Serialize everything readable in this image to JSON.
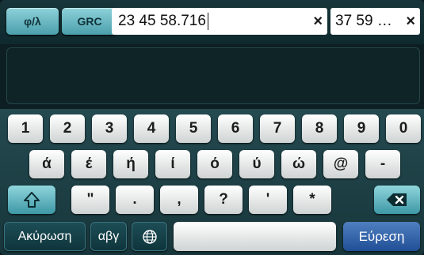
{
  "topbar": {
    "mode_phi_label": "φ/λ",
    "mode_grc_label": "GRC",
    "lon_value": "23 45 58.716",
    "lat_value": "37 59 …",
    "clear_symbol": "×"
  },
  "keyboard": {
    "row1": [
      "1",
      "2",
      "3",
      "4",
      "5",
      "6",
      "7",
      "8",
      "9",
      "0"
    ],
    "row2": [
      "ά",
      "έ",
      "ή",
      "ί",
      "ό",
      "ύ",
      "ώ",
      "@",
      "-"
    ],
    "row3": [
      "\"",
      ".",
      ",",
      "?",
      "'",
      "*"
    ],
    "cancel_label": "Ακύρωση",
    "alpha_label": "αβγ",
    "search_label": "Εύρεση",
    "icons": [
      "shift-icon",
      "backspace-icon",
      "globe-icon"
    ]
  },
  "colors": {
    "accent_teal": "#5aaab5",
    "search_blue": "#2a5aa3",
    "background": "#0d1f22"
  }
}
